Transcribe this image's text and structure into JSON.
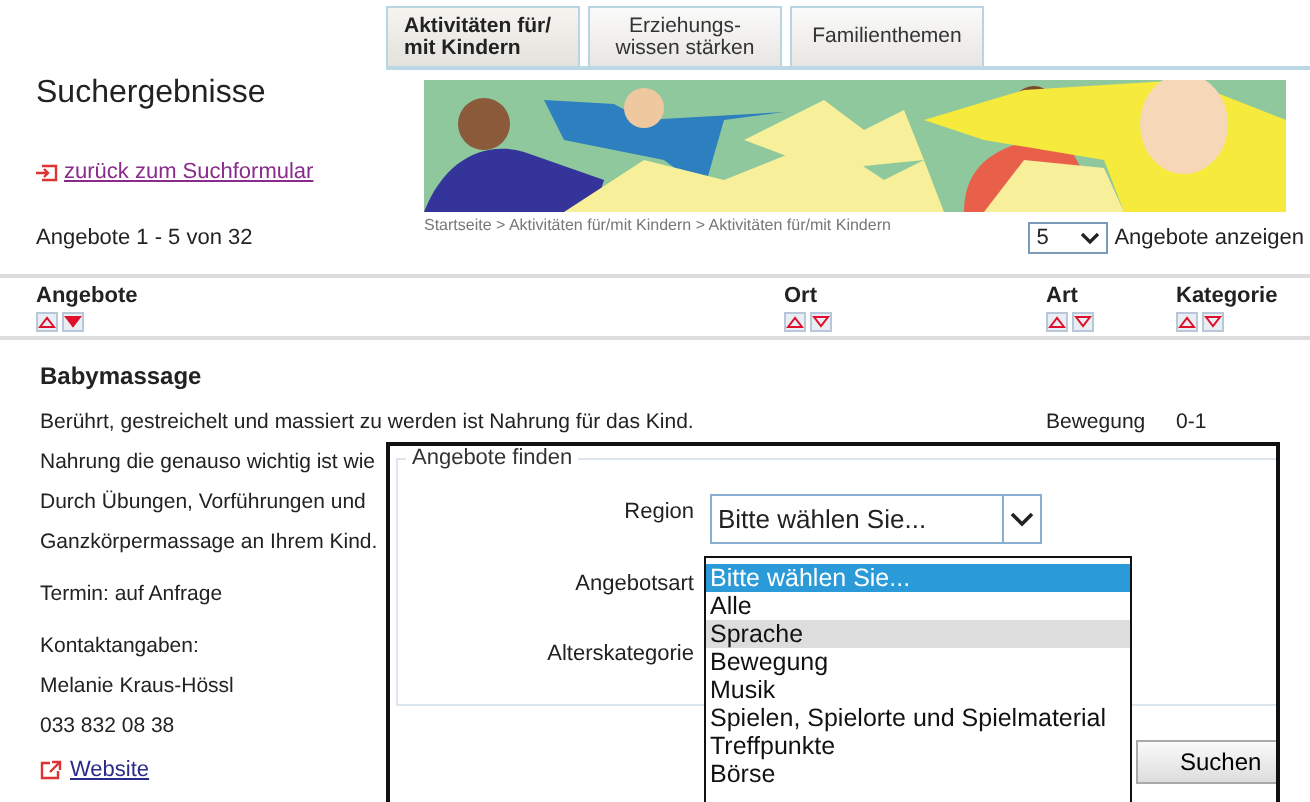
{
  "tabs": [
    {
      "label": "Aktivitäten für/ mit Kindern",
      "selected": true
    },
    {
      "label": "Erziehungs- wissen stärken",
      "selected": false
    },
    {
      "label": "Familienthemen",
      "selected": false
    }
  ],
  "page_title": "Suchergebnisse",
  "back_link": "zurück zum Suchformular",
  "breadcrumb": "Startseite >  Aktivitäten für/mit Kindern >  Aktivitäten für/mit Kindern",
  "result_count": "Angebote 1 - 5 von 32",
  "page_size": {
    "value": "5",
    "label": "Angebote anzeigen"
  },
  "table": {
    "columns": [
      {
        "label": "Angebote",
        "sorted_descending": true
      },
      {
        "label": "Ort",
        "sorted_descending": false
      },
      {
        "label": "Art",
        "sorted_descending": false
      },
      {
        "label": "Kategorie",
        "sorted_descending": false
      }
    ]
  },
  "result": {
    "title": "Babymassage",
    "description_lines": [
      "Berührt, gestreichelt und massiert zu werden ist Nahrung für das Kind.",
      "Nahrung die genauso wichtig ist wie",
      "Durch Übungen, Vorführungen und",
      "Ganzkörpermassage an Ihrem Kind."
    ],
    "art": "Bewegung",
    "kategorie": "0-1",
    "termin": "Termin: auf Anfrage",
    "contact_label": "Kontaktangaben:",
    "contact_name": "Melanie Kraus-Hössl",
    "phone": "033 832 08 38",
    "website": "Website"
  },
  "search_dialog": {
    "legend": "Angebote finden",
    "region": {
      "label": "Region",
      "value": "Bitte wählen Sie..."
    },
    "angebotsart": {
      "label": "Angebotsart",
      "options": [
        {
          "label": "Bitte wählen Sie...",
          "selected": true,
          "highlighted": false
        },
        {
          "label": "Alle",
          "selected": false,
          "highlighted": false
        },
        {
          "label": "Sprache",
          "selected": false,
          "highlighted": true
        },
        {
          "label": "Bewegung",
          "selected": false,
          "highlighted": false
        },
        {
          "label": "Musik",
          "selected": false,
          "highlighted": false
        },
        {
          "label": "Spielen, Spielorte und Spielmaterial",
          "selected": false,
          "highlighted": false
        },
        {
          "label": "Treffpunkte",
          "selected": false,
          "highlighted": false
        },
        {
          "label": "Börse",
          "selected": false,
          "highlighted": false
        }
      ]
    },
    "alterskategorie": {
      "label": "Alterskategorie"
    },
    "submit": "Suchen"
  }
}
